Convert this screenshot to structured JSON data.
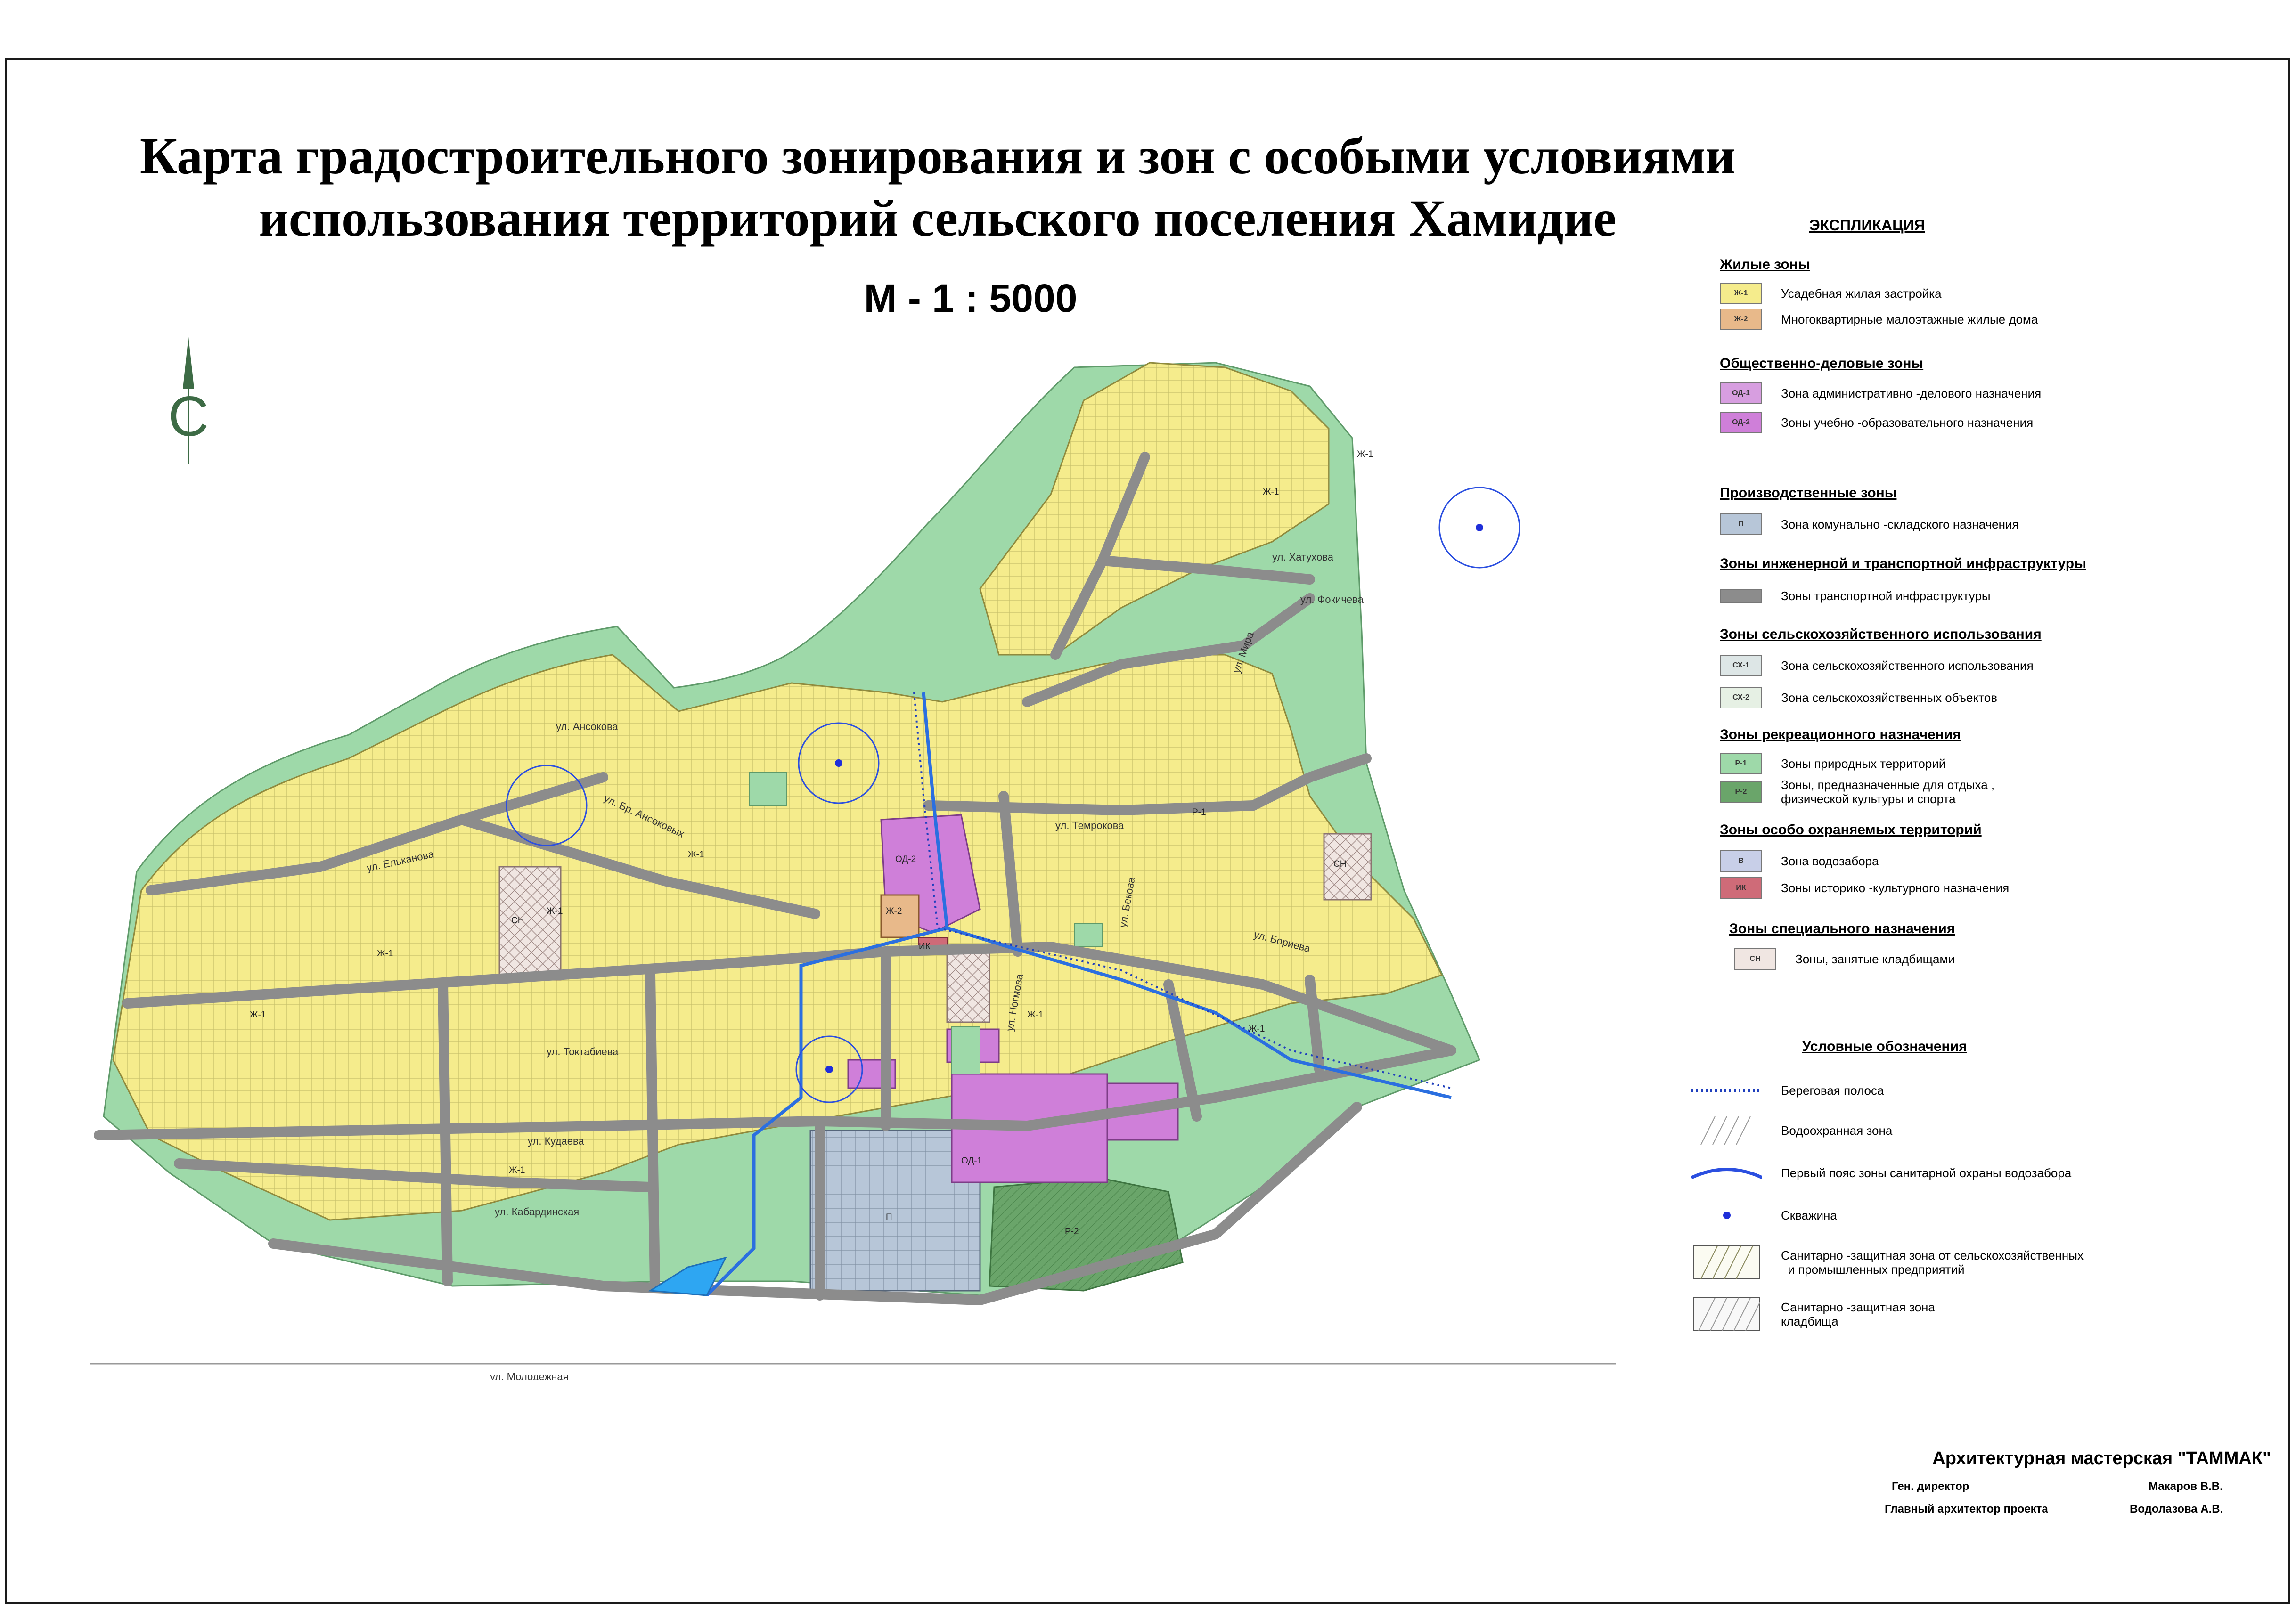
{
  "title": {
    "line1": "Карта градостроительного зонирования и зон с особыми условиями",
    "line2": "использования территорий сельского поселения Хамидие"
  },
  "scale": "М - 1 : 5000",
  "north_arrow": {
    "letter": "С",
    "icon": "north-arrow-icon"
  },
  "legend": {
    "heading": "ЭКСПЛИКАЦИЯ",
    "sections": [
      {
        "title": "Жилые зоны",
        "items": [
          {
            "code": "Ж-1",
            "label": "Усадебная жилая застройка",
            "color": "#f5ec8c"
          },
          {
            "code": "Ж-2",
            "label": "Многоквартирные малоэтажные жилые дома",
            "color": "#e8b98a"
          }
        ]
      },
      {
        "title": "Общественно-деловые зоны",
        "items": [
          {
            "code": "ОД-1",
            "label": "Зона административно -делового назначения",
            "color": "#d79ee0"
          },
          {
            "code": "ОД-2",
            "label": "Зоны учебно -образовательного назначения",
            "color": "#cf7fd9"
          }
        ]
      },
      {
        "title": "Производственные зоны",
        "items": [
          {
            "code": "П",
            "label": "Зона комунально -складского назначения",
            "color": "#b7c6d8"
          }
        ]
      },
      {
        "title": "Зоны инженерной и транспортной   инфраструктуры",
        "items": [
          {
            "code": "",
            "label": "Зоны транспортной инфраструктуры",
            "color": "#8c8c8c"
          }
        ]
      },
      {
        "title": "Зоны сельскохозяйственного использования",
        "items": [
          {
            "code": "СХ-1",
            "label": "Зона сельскохозяйственного использования",
            "color": "#dde6e6"
          },
          {
            "code": "СХ-2",
            "label": "Зона сельскохозяйственных объектов",
            "color": "#e6f0e4"
          }
        ]
      },
      {
        "title": "Зоны рекреационного назначения",
        "items": [
          {
            "code": "Р-1",
            "label": "Зоны природных территорий",
            "color": "#9ed9a9"
          },
          {
            "code": "Р-2",
            "label": "Зоны, предназначенные для отдыха ,\nфизической культуры и спорта",
            "color": "#6aa56a"
          }
        ]
      },
      {
        "title": "Зоны особо охраняемых территорий",
        "items": [
          {
            "code": "В",
            "label": "Зона водозабора",
            "color": "#c8cfe8"
          },
          {
            "code": "ИК",
            "label": "Зоны историко -культурного назначения",
            "color": "#cf6b78"
          }
        ]
      },
      {
        "title": "Зоны специального назначения",
        "items": [
          {
            "code": "СН",
            "label": "Зоны, занятые кладбищами",
            "color": "#f0e6e2"
          }
        ]
      }
    ],
    "symbols_title": "Условные обозначения",
    "symbols": [
      {
        "kind": "dotted-line",
        "label": "Береговая полоса"
      },
      {
        "kind": "hatch",
        "label": "Водоохранная зона"
      },
      {
        "kind": "blue-arc",
        "label": "Первый пояс зоны санитарной охраны водозабора"
      },
      {
        "kind": "dot",
        "label": "Скважина"
      },
      {
        "kind": "box-hatch",
        "label": "Санитарно -защитная зона от сельскохозяйственных\n  и промышленных предприятий"
      },
      {
        "kind": "box-hatch-fine",
        "label": "Санитарно -защитная зона\nкладбища"
      }
    ]
  },
  "map": {
    "zone_labels": [
      "Ж-1",
      "Ж-2",
      "ОД-1",
      "ОД-2",
      "П",
      "Р-1",
      "Р-2",
      "СН",
      "ИК"
    ],
    "streets": [
      "ул. Хатухова",
      "ул. Фокичева",
      "ул. Мира",
      "ул. Темрокова",
      "ул. Ансокова",
      "ул. Бр. Ансоковых",
      "ул. Токтабиева",
      "ул. Ельканова",
      "ул. Бориева",
      "ул. Кудаева",
      "ул. Кабардинская",
      "ул. Молодежная",
      "ул. Ногмова",
      "ул. Бекова"
    ]
  },
  "footer": {
    "firm": "Архитектурная мастерская \"ТАММАК\"",
    "role1": "Ген. директор",
    "name1": "Макаров В.В.",
    "role2": "Главный архитектор проекта",
    "name2": "Водолазова А.В."
  },
  "colors": {
    "residential": "#f5ec8c",
    "residential_outline": "#8f8a3d",
    "road": "#8c8c8c",
    "green": "#9ed9a9",
    "dark_green": "#6aa56a",
    "purple": "#cf7fd9",
    "industrial": "#b7c6d8",
    "water": "#2b6fe0"
  }
}
